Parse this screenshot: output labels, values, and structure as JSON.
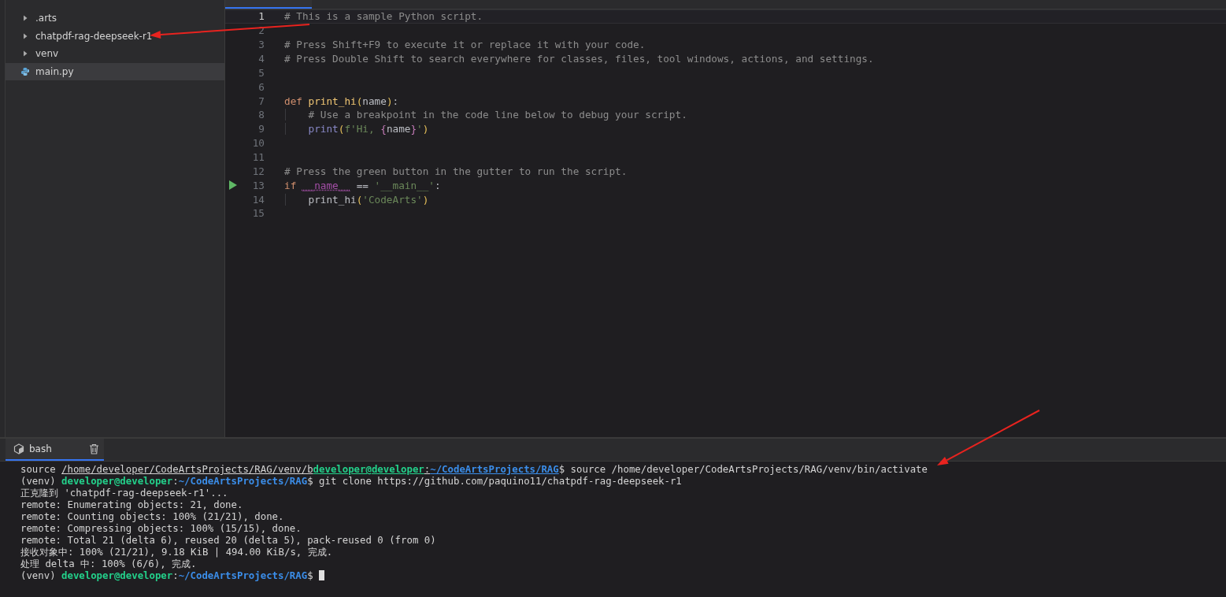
{
  "sidebar": {
    "items": [
      {
        "label": ".arts",
        "kind": "folder",
        "expanded": false,
        "selected": false
      },
      {
        "label": "chatpdf-rag-deepseek-r1",
        "kind": "folder",
        "expanded": false,
        "selected": false
      },
      {
        "label": "venv",
        "kind": "folder",
        "expanded": false,
        "selected": false
      },
      {
        "label": "main.py",
        "kind": "python",
        "selected": true
      }
    ]
  },
  "editor": {
    "lines": [
      {
        "n": "1",
        "current": true,
        "run": false,
        "tokens": [
          {
            "t": "# This is a sample Python script.",
            "kind": "comment"
          }
        ]
      },
      {
        "n": "2",
        "current": false,
        "run": false
      },
      {
        "n": "3",
        "current": false,
        "run": false,
        "tokens": [
          {
            "t": "# Press Shift+F9 to execute it or replace it with your code.",
            "kind": "comment"
          }
        ]
      },
      {
        "n": "4",
        "current": false,
        "run": false,
        "tokens": [
          {
            "t": "# Press Double Shift to search everywhere for classes, files, tool windows, actions, and settings.",
            "kind": "comment"
          }
        ]
      },
      {
        "n": "5",
        "current": false,
        "run": false
      },
      {
        "n": "6",
        "current": false,
        "run": false
      },
      {
        "n": "7",
        "current": false,
        "run": false,
        "tokens": [
          {
            "t": "def ",
            "kind": "keyword"
          },
          {
            "t": "print_hi",
            "kind": "func"
          },
          {
            "t": "(",
            "kind": "paren"
          },
          {
            "t": "name",
            "kind": "ident"
          },
          {
            "t": ")",
            "kind": "paren"
          },
          {
            "t": ":",
            "kind": "ident"
          }
        ]
      },
      {
        "n": "8",
        "current": false,
        "run": false,
        "indent": true,
        "tokens": [
          {
            "t": "# Use a breakpoint in the code line below to debug your script.",
            "kind": "comment"
          }
        ]
      },
      {
        "n": "9",
        "current": false,
        "run": false,
        "indent": true,
        "tokens": [
          {
            "t": "print",
            "kind": "builtin"
          },
          {
            "t": "(",
            "kind": "paren"
          },
          {
            "t": "f'Hi, ",
            "kind": "string"
          },
          {
            "t": "{",
            "kind": "brace"
          },
          {
            "t": "name",
            "kind": "ident"
          },
          {
            "t": "}",
            "kind": "brace"
          },
          {
            "t": "'",
            "kind": "string"
          },
          {
            "t": ")",
            "kind": "paren"
          }
        ]
      },
      {
        "n": "10",
        "current": false,
        "run": false
      },
      {
        "n": "11",
        "current": false,
        "run": false
      },
      {
        "n": "12",
        "current": false,
        "run": false,
        "tokens": [
          {
            "t": "# Press the green button in the gutter to run the script.",
            "kind": "comment"
          }
        ]
      },
      {
        "n": "13",
        "current": false,
        "run": true,
        "tokens": [
          {
            "t": "if ",
            "kind": "keyword"
          },
          {
            "t": "__name__",
            "kind": "dunder"
          },
          {
            "t": " == ",
            "kind": "ident"
          },
          {
            "t": "'__main__'",
            "kind": "string"
          },
          {
            "t": ":",
            "kind": "ident"
          }
        ]
      },
      {
        "n": "14",
        "current": false,
        "run": false,
        "indent": true,
        "tokens": [
          {
            "t": "print_hi",
            "kind": "ident"
          },
          {
            "t": "(",
            "kind": "paren"
          },
          {
            "t": "'CodeArts'",
            "kind": "string"
          },
          {
            "t": ")",
            "kind": "paren"
          }
        ]
      },
      {
        "n": "15",
        "current": false,
        "run": false
      }
    ]
  },
  "terminal": {
    "tab": {
      "label": "bash",
      "selected": true
    },
    "cursor": true,
    "lines": [
      [
        {
          "t": "source ",
          "kind": "plain"
        },
        {
          "t": "/home/developer/CodeArtsProjects/RAG/venv/b",
          "kind": "plain",
          "underlined": true
        },
        {
          "t": "developer@developer",
          "kind": "user",
          "underlined": true
        },
        {
          "t": ":",
          "kind": "plain",
          "underlined": true
        },
        {
          "t": "~/CodeArtsProjects/RAG",
          "kind": "path",
          "underlined": true
        },
        {
          "t": "$ source /home/developer/CodeArtsProjects/RAG/venv/bin/activate",
          "kind": "plain"
        }
      ],
      [
        {
          "t": "(venv) ",
          "kind": "plain"
        },
        {
          "t": "developer@developer",
          "kind": "user"
        },
        {
          "t": ":",
          "kind": "plain"
        },
        {
          "t": "~/CodeArtsProjects/RAG",
          "kind": "path"
        },
        {
          "t": "$ git clone https://github.com/paquino11/chatpdf-rag-deepseek-r1",
          "kind": "plain"
        }
      ],
      [
        {
          "t": "正克隆到 'chatpdf-rag-deepseek-r1'...",
          "kind": "plain"
        }
      ],
      [
        {
          "t": "remote: Enumerating objects: 21, done.",
          "kind": "plain"
        }
      ],
      [
        {
          "t": "remote: Counting objects: 100% (21/21), done.",
          "kind": "plain"
        }
      ],
      [
        {
          "t": "remote: Compressing objects: 100% (15/15), done.",
          "kind": "plain"
        }
      ],
      [
        {
          "t": "remote: Total 21 (delta 6), reused 20 (delta 5), pack-reused 0 (from 0)",
          "kind": "plain"
        }
      ],
      [
        {
          "t": "接收对象中: 100% (21/21), 9.18 KiB | 494.00 KiB/s, 完成.",
          "kind": "plain"
        }
      ],
      [
        {
          "t": "处理 delta 中: 100% (6/6), 完成.",
          "kind": "plain"
        }
      ],
      [
        {
          "t": "(venv) ",
          "kind": "plain"
        },
        {
          "t": "developer@developer",
          "kind": "user"
        },
        {
          "t": ":",
          "kind": "plain"
        },
        {
          "t": "~/CodeArtsProjects/RAG",
          "kind": "path"
        },
        {
          "t": "$",
          "kind": "plain"
        }
      ]
    ]
  },
  "annotations": [
    {
      "kind": "arrow"
    },
    {
      "kind": "arrow"
    }
  ]
}
